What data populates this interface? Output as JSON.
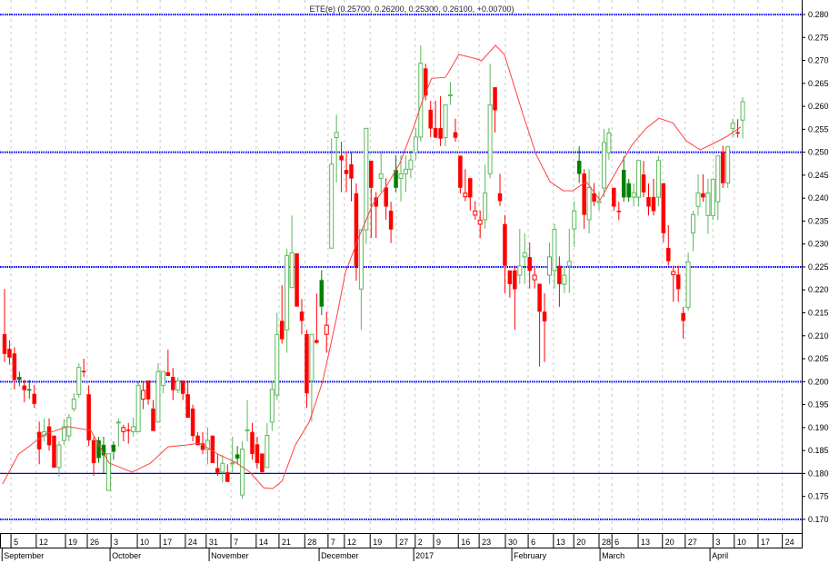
{
  "title": "ETE(e) (0.25700, 0.26200, 0.25300, 0.26100, +0.00700)",
  "colors": {
    "up": "#5cb85c",
    "up_filled": "#008000",
    "down": "#ff0000",
    "ma": "#ff4040",
    "level": "#0000ff",
    "grid": "#c8c8c8"
  },
  "chart_data": {
    "type": "candlestick",
    "title": "ETE(e) (0.25700, 0.26200, 0.25300, 0.26100, +0.00700)",
    "ylim": [
      0.17,
      0.28
    ],
    "yticks": [
      "0.280",
      "0.275",
      "0.270",
      "0.265",
      "0.260",
      "0.255",
      "0.250",
      "0.245",
      "0.240",
      "0.235",
      "0.230",
      "0.225",
      "0.220",
      "0.215",
      "0.210",
      "0.205",
      "0.200",
      "0.195",
      "0.190",
      "0.185",
      "0.180",
      "0.175",
      "0.170"
    ],
    "levels": [
      {
        "value": 0.28,
        "style": "dotted"
      },
      {
        "value": 0.25,
        "style": "dotted"
      },
      {
        "value": 0.225,
        "style": "dotted"
      },
      {
        "value": 0.2,
        "style": "dotted"
      },
      {
        "value": 0.18,
        "style": "solid"
      },
      {
        "value": 0.17,
        "style": "dotted"
      }
    ],
    "ohlc": [
      [
        0.2103,
        0.2202,
        0.2043,
        0.2061
      ],
      [
        0.2071,
        0.209,
        0.2037,
        0.2053
      ],
      [
        0.2061,
        0.2075,
        0.1983,
        0.2004
      ],
      [
        0.201,
        0.2022,
        0.199,
        0.2004
      ],
      [
        0.1991,
        0.2004,
        0.1955,
        0.1982
      ],
      [
        0.1983,
        0.2004,
        0.1963,
        0.1982
      ],
      [
        0.1973,
        0.1993,
        0.1943,
        0.1952
      ],
      [
        0.189,
        0.1913,
        0.182,
        0.1853
      ],
      [
        0.1882,
        0.192,
        0.187,
        0.1891
      ],
      [
        0.1902,
        0.192,
        0.185,
        0.1862
      ],
      [
        0.1882,
        0.1882,
        0.1813,
        0.1813
      ],
      [
        0.1813,
        0.187,
        0.1793,
        0.1862
      ],
      [
        0.1872,
        0.1918,
        0.1862,
        0.1902
      ],
      [
        0.1882,
        0.193,
        0.187,
        0.1922
      ],
      [
        0.1941,
        0.1975,
        0.1935,
        0.1962
      ],
      [
        0.1972,
        0.204,
        0.1965,
        0.2031
      ],
      [
        0.2023,
        0.205,
        0.201,
        0.2022
      ],
      [
        0.1972,
        0.1992,
        0.186,
        0.1873
      ],
      [
        0.1872,
        0.188,
        0.1795,
        0.1823
      ],
      [
        0.1872,
        0.188,
        0.1823,
        0.1834
      ],
      [
        0.1862,
        0.188,
        0.18,
        0.184
      ],
      [
        0.1763,
        0.1843,
        0.1763,
        0.1843
      ],
      [
        0.1862,
        0.187,
        0.183,
        0.1848
      ],
      [
        0.1911,
        0.192,
        0.1858,
        0.1912
      ],
      [
        0.1891,
        0.1906,
        0.187,
        0.19
      ],
      [
        0.1895,
        0.191,
        0.1865,
        0.1895
      ],
      [
        0.1891,
        0.1922,
        0.188,
        0.1902
      ],
      [
        0.1891,
        0.2,
        0.1891,
        0.1992
      ],
      [
        0.1962,
        0.2,
        0.194,
        0.1981
      ],
      [
        0.2002,
        0.2002,
        0.195,
        0.1962
      ],
      [
        0.1941,
        0.196,
        0.1893,
        0.1893
      ],
      [
        0.1912,
        0.204,
        0.1912,
        0.2022
      ],
      [
        0.1992,
        0.2022,
        0.1975,
        0.2022
      ],
      [
        0.202,
        0.207,
        0.2013,
        0.2013
      ],
      [
        0.201,
        0.203,
        0.196,
        0.1982
      ],
      [
        0.1982,
        0.201,
        0.1975,
        0.2002
      ],
      [
        0.2002,
        0.2002,
        0.196,
        0.1974
      ],
      [
        0.1972,
        0.2002,
        0.1922,
        0.1922
      ],
      [
        0.1941,
        0.195,
        0.187,
        0.1882
      ],
      [
        0.1882,
        0.189,
        0.1862,
        0.1862
      ],
      [
        0.1865,
        0.189,
        0.1842,
        0.1852
      ],
      [
        0.1852,
        0.19,
        0.182,
        0.1872
      ],
      [
        0.1882,
        0.1882,
        0.1823,
        0.1823
      ],
      [
        0.1811,
        0.1842,
        0.1795,
        0.1802
      ],
      [
        0.1803,
        0.184,
        0.178,
        0.1822
      ],
      [
        0.1802,
        0.182,
        0.1782,
        0.1782
      ],
      [
        0.1822,
        0.188,
        0.18,
        0.1823
      ],
      [
        0.1841,
        0.186,
        0.182,
        0.1833
      ],
      [
        0.1753,
        0.187,
        0.1745,
        0.1853
      ],
      [
        0.1894,
        0.196,
        0.187,
        0.1895
      ],
      [
        0.189,
        0.191,
        0.183,
        0.1843
      ],
      [
        0.1863,
        0.188,
        0.181,
        0.1823
      ],
      [
        0.1843,
        0.1843,
        0.1803,
        0.1803
      ],
      [
        0.1813,
        0.191,
        0.1813,
        0.1883
      ],
      [
        0.1912,
        0.2,
        0.1893,
        0.1983
      ],
      [
        0.1971,
        0.215,
        0.196,
        0.2103
      ],
      [
        0.2132,
        0.221,
        0.2083,
        0.2093
      ],
      [
        0.2113,
        0.229,
        0.2063,
        0.2275
      ],
      [
        0.2205,
        0.2362,
        0.2205,
        0.2281
      ],
      [
        0.2279,
        0.2279,
        0.2164,
        0.2164
      ],
      [
        0.2152,
        0.218,
        0.2103,
        0.2133
      ],
      [
        0.2103,
        0.2113,
        0.1943,
        0.1975
      ],
      [
        0.2002,
        0.2103,
        0.1913,
        0.2103
      ],
      [
        0.209,
        0.2192,
        0.2083,
        0.2085
      ],
      [
        0.2221,
        0.2243,
        0.2145,
        0.2164
      ],
      [
        0.2103,
        0.2152,
        0.2063,
        0.2123
      ],
      [
        0.2291,
        0.253,
        0.2291,
        0.2474
      ],
      [
        0.2532,
        0.2582,
        0.2434,
        0.2543
      ],
      [
        0.2492,
        0.2523,
        0.2413,
        0.2483
      ],
      [
        0.2461,
        0.2502,
        0.2413,
        0.2453
      ],
      [
        0.2473,
        0.25,
        0.2393,
        0.2443
      ],
      [
        0.241,
        0.2432,
        0.222,
        0.2252
      ],
      [
        0.2202,
        0.2331,
        0.2113,
        0.2331
      ],
      [
        0.2331,
        0.2552,
        0.23,
        0.2552
      ],
      [
        0.2481,
        0.2481,
        0.2313,
        0.2423
      ],
      [
        0.2401,
        0.2413,
        0.2313,
        0.2382
      ],
      [
        0.2443,
        0.2502,
        0.2413,
        0.2453
      ],
      [
        0.2423,
        0.2443,
        0.2353,
        0.2382
      ],
      [
        0.2372,
        0.2392,
        0.2302,
        0.2332
      ],
      [
        0.2461,
        0.2493,
        0.2413,
        0.2423
      ],
      [
        0.2443,
        0.2493,
        0.2393,
        0.2453
      ],
      [
        0.2453,
        0.2493,
        0.2413,
        0.2463
      ],
      [
        0.2463,
        0.2503,
        0.2443,
        0.2483
      ],
      [
        0.2499,
        0.2553,
        0.2483,
        0.2533
      ],
      [
        0.2533,
        0.2733,
        0.2523,
        0.2694
      ],
      [
        0.2682,
        0.2693,
        0.2613,
        0.2624
      ],
      [
        0.2592,
        0.2612,
        0.2533,
        0.2552
      ],
      [
        0.2552,
        0.2612,
        0.2532,
        0.2532
      ],
      [
        0.2552,
        0.2622,
        0.2513,
        0.253
      ],
      [
        0.2532,
        0.2603,
        0.2513,
        0.2603
      ],
      [
        0.2624,
        0.2653,
        0.2603,
        0.2625
      ],
      [
        0.2543,
        0.2573,
        0.2523,
        0.2532
      ],
      [
        0.2492,
        0.2492,
        0.241,
        0.2423
      ],
      [
        0.2403,
        0.2463,
        0.2393,
        0.2411
      ],
      [
        0.2443,
        0.2443,
        0.2373,
        0.2402
      ],
      [
        0.2363,
        0.2393,
        0.2353,
        0.2372
      ],
      [
        0.2343,
        0.2373,
        0.2313,
        0.2352
      ],
      [
        0.2353,
        0.2473,
        0.2333,
        0.2411
      ],
      [
        0.2453,
        0.2693,
        0.2443,
        0.2603
      ],
      [
        0.2641,
        0.2641,
        0.2543,
        0.2592
      ],
      [
        0.241,
        0.2453,
        0.2383,
        0.2394
      ],
      [
        0.2343,
        0.2363,
        0.2193,
        0.2253
      ],
      [
        0.2242,
        0.2242,
        0.2183,
        0.2213
      ],
      [
        0.2242,
        0.2253,
        0.2113,
        0.2202
      ],
      [
        0.2232,
        0.2333,
        0.2213,
        0.2252
      ],
      [
        0.2272,
        0.2323,
        0.2213,
        0.2281
      ],
      [
        0.2271,
        0.2303,
        0.2203,
        0.2242
      ],
      [
        0.2222,
        0.2253,
        0.2203,
        0.2232
      ],
      [
        0.2213,
        0.2213,
        0.2033,
        0.2153
      ],
      [
        0.2152,
        0.2193,
        0.2043,
        0.2132
      ],
      [
        0.2232,
        0.2303,
        0.2213,
        0.2272
      ],
      [
        0.2242,
        0.2343,
        0.2203,
        0.2332
      ],
      [
        0.2252,
        0.2273,
        0.2163,
        0.2213
      ],
      [
        0.2212,
        0.2253,
        0.2193,
        0.2232
      ],
      [
        0.2252,
        0.2333,
        0.2193,
        0.2262
      ],
      [
        0.2333,
        0.2393,
        0.2293,
        0.2372
      ],
      [
        0.2481,
        0.2513,
        0.2433,
        0.2453
      ],
      [
        0.2453,
        0.2463,
        0.2333,
        0.2364
      ],
      [
        0.2353,
        0.2463,
        0.2323,
        0.2423
      ],
      [
        0.241,
        0.2433,
        0.2383,
        0.2393
      ],
      [
        0.239,
        0.2413,
        0.2373,
        0.2393
      ],
      [
        0.2422,
        0.2551,
        0.2402,
        0.2521
      ],
      [
        0.2499,
        0.2553,
        0.2483,
        0.2542
      ],
      [
        0.2422,
        0.2422,
        0.2373,
        0.2382
      ],
      [
        0.2372,
        0.2392,
        0.2352,
        0.2372
      ],
      [
        0.2461,
        0.2491,
        0.2392,
        0.2402
      ],
      [
        0.2432,
        0.2442,
        0.2392,
        0.2402
      ],
      [
        0.2402,
        0.2432,
        0.2382,
        0.2412
      ],
      [
        0.2402,
        0.2482,
        0.2382,
        0.2482
      ],
      [
        0.2451,
        0.2481,
        0.2402,
        0.2413
      ],
      [
        0.2402,
        0.2432,
        0.2362,
        0.2382
      ],
      [
        0.2402,
        0.2442,
        0.2362,
        0.2372
      ],
      [
        0.2402,
        0.2492,
        0.2382,
        0.2482
      ],
      [
        0.2432,
        0.2432,
        0.2304,
        0.2324
      ],
      [
        0.2291,
        0.2341,
        0.2253,
        0.2263
      ],
      [
        0.2233,
        0.2253,
        0.2174,
        0.224
      ],
      [
        0.2233,
        0.2253,
        0.2174,
        0.2202
      ],
      [
        0.2149,
        0.2163,
        0.2094,
        0.2133
      ],
      [
        0.2162,
        0.2281,
        0.2154,
        0.2261
      ],
      [
        0.2324,
        0.2372,
        0.2284,
        0.2364
      ],
      [
        0.2382,
        0.2452,
        0.2362,
        0.2411
      ],
      [
        0.241,
        0.2452,
        0.2392,
        0.2402
      ],
      [
        0.2362,
        0.2442,
        0.2322,
        0.2411
      ],
      [
        0.2362,
        0.2441,
        0.2352,
        0.2441
      ],
      [
        0.2392,
        0.2492,
        0.2352,
        0.2492
      ],
      [
        0.25,
        0.2514,
        0.2422,
        0.2433
      ],
      [
        0.2433,
        0.2512,
        0.2422,
        0.2512
      ],
      [
        0.2552,
        0.2573,
        0.2532,
        0.2563
      ],
      [
        0.2543,
        0.2572,
        0.2532,
        0.2543
      ],
      [
        0.257,
        0.262,
        0.253,
        0.261
      ]
    ],
    "moving_average": [
      [
        -0.4,
        0.1777
      ],
      [
        2.8,
        0.1842
      ],
      [
        8.3,
        0.1886
      ],
      [
        12.8,
        0.1902
      ],
      [
        17.4,
        0.1894
      ],
      [
        21.1,
        0.1823
      ],
      [
        25.7,
        0.1803
      ],
      [
        29.4,
        0.1822
      ],
      [
        33,
        0.1858
      ],
      [
        36.7,
        0.1862
      ],
      [
        39.4,
        0.1866
      ],
      [
        43.1,
        0.1842
      ],
      [
        46.8,
        0.1823
      ],
      [
        49.5,
        0.1803
      ],
      [
        52.3,
        0.1769
      ],
      [
        54.1,
        0.1767
      ],
      [
        56,
        0.1783
      ],
      [
        58.7,
        0.1862
      ],
      [
        61.5,
        0.1912
      ],
      [
        64.2,
        0.2
      ],
      [
        67,
        0.2139
      ],
      [
        68.8,
        0.2238
      ],
      [
        71.6,
        0.2317
      ],
      [
        74.3,
        0.2386
      ],
      [
        77.1,
        0.2426
      ],
      [
        79.8,
        0.2476
      ],
      [
        82.6,
        0.2555
      ],
      [
        84.4,
        0.2614
      ],
      [
        86.2,
        0.2661
      ],
      [
        89,
        0.2663
      ],
      [
        91.7,
        0.2713
      ],
      [
        95.4,
        0.2703
      ],
      [
        96.3,
        0.2699
      ],
      [
        99.1,
        0.2733
      ],
      [
        100.9,
        0.2713
      ],
      [
        104.6,
        0.2584
      ],
      [
        107.3,
        0.2495
      ],
      [
        110.1,
        0.2436
      ],
      [
        112.8,
        0.2416
      ],
      [
        114.7,
        0.2416
      ],
      [
        117.4,
        0.2436
      ],
      [
        120.2,
        0.2396
      ],
      [
        123.9,
        0.2466
      ],
      [
        126.6,
        0.2515
      ],
      [
        129.4,
        0.2551
      ],
      [
        132.1,
        0.2574
      ],
      [
        134.9,
        0.2564
      ],
      [
        137.6,
        0.2525
      ],
      [
        140.4,
        0.2505
      ],
      [
        143.1,
        0.2519
      ],
      [
        145.9,
        0.2535
      ],
      [
        148.6,
        0.2555
      ]
    ],
    "xticks": [
      {
        "label": "5",
        "i": 1.3
      },
      {
        "label": "12",
        "i": 6.4
      },
      {
        "label": "19",
        "i": 12.3
      },
      {
        "label": "26",
        "i": 16.7
      },
      {
        "label": "3",
        "i": 21.5
      },
      {
        "label": "10",
        "i": 26.8
      },
      {
        "label": "17",
        "i": 31.4
      },
      {
        "label": "24",
        "i": 36.5
      },
      {
        "label": "31",
        "i": 40.7
      },
      {
        "label": "7",
        "i": 45.7
      },
      {
        "label": "14",
        "i": 50.8
      },
      {
        "label": "21",
        "i": 55.4
      },
      {
        "label": "28",
        "i": 60.6
      },
      {
        "label": "7",
        "i": 65.3
      },
      {
        "label": "12",
        "i": 68.6
      },
      {
        "label": "19",
        "i": 73.8
      },
      {
        "label": "27",
        "i": 79.1
      },
      {
        "label": "2",
        "i": 82.9
      },
      {
        "label": "9",
        "i": 86.6
      },
      {
        "label": "16",
        "i": 91.6
      },
      {
        "label": "23",
        "i": 95.8
      },
      {
        "label": "30",
        "i": 101.1
      },
      {
        "label": "6",
        "i": 105.7
      },
      {
        "label": "13",
        "i": 110.8
      },
      {
        "label": "20",
        "i": 114.9
      },
      {
        "label": "28",
        "i": 120
      },
      {
        "label": "6",
        "i": 122.6
      },
      {
        "label": "13",
        "i": 127.9
      },
      {
        "label": "20",
        "i": 132.8
      },
      {
        "label": "27",
        "i": 137.4
      },
      {
        "label": "3",
        "i": 143
      },
      {
        "label": "10",
        "i": 147.3
      },
      {
        "label": "17",
        "i": 152.1
      },
      {
        "label": "24",
        "i": 157
      }
    ],
    "months": [
      {
        "label": "September",
        "i": -0.5
      },
      {
        "label": "October",
        "i": 21.3
      },
      {
        "label": "November",
        "i": 41.3
      },
      {
        "label": "December",
        "i": 63.5
      },
      {
        "label": "2017",
        "i": 82.6
      },
      {
        "label": "February",
        "i": 102.4
      },
      {
        "label": "March",
        "i": 120.2
      },
      {
        "label": "April",
        "i": 142.4
      }
    ]
  }
}
